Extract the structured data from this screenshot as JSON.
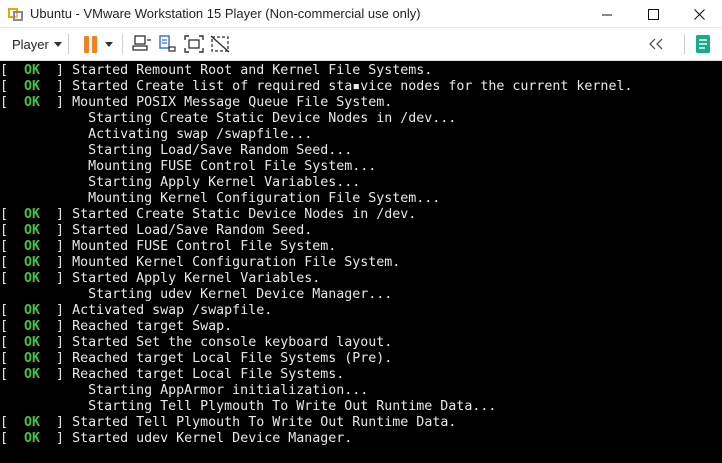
{
  "window": {
    "title": "Ubuntu - VMware Workstation 15 Player (Non-commercial use only)"
  },
  "toolbar": {
    "player_label": "Player",
    "icons": [
      "pause-icon",
      "dropdown-icon",
      "send-ctrl-alt-del-icon",
      "removable-devices-icon",
      "fit-guest-icon",
      "unity-icon",
      "back-icon",
      "library-notes-icon"
    ]
  },
  "colors": {
    "ok": "#3dc63d",
    "pause": "#f08020",
    "notes": "#1aaa8a",
    "console_text": "#e8e8e8"
  },
  "console": {
    "lines": [
      {
        "status": "OK",
        "text": "Started Remount Root and Kernel File Systems."
      },
      {
        "status": "OK",
        "text": "Started Create list of required sta▪vice nodes for the current kernel."
      },
      {
        "status": "OK",
        "text": "Mounted POSIX Message Queue File System."
      },
      {
        "status": "",
        "text": "Starting Create Static Device Nodes in /dev..."
      },
      {
        "status": "",
        "text": "Activating swap /swapfile..."
      },
      {
        "status": "",
        "text": "Starting Load/Save Random Seed..."
      },
      {
        "status": "",
        "text": "Mounting FUSE Control File System..."
      },
      {
        "status": "",
        "text": "Starting Apply Kernel Variables..."
      },
      {
        "status": "",
        "text": "Mounting Kernel Configuration File System..."
      },
      {
        "status": "OK",
        "text": "Started Create Static Device Nodes in /dev."
      },
      {
        "status": "OK",
        "text": "Started Load/Save Random Seed."
      },
      {
        "status": "OK",
        "text": "Mounted FUSE Control File System."
      },
      {
        "status": "OK",
        "text": "Mounted Kernel Configuration File System."
      },
      {
        "status": "OK",
        "text": "Started Apply Kernel Variables."
      },
      {
        "status": "",
        "text": "Starting udev Kernel Device Manager..."
      },
      {
        "status": "OK",
        "text": "Activated swap /swapfile."
      },
      {
        "status": "OK",
        "text": "Reached target Swap."
      },
      {
        "status": "OK",
        "text": "Started Set the console keyboard layout."
      },
      {
        "status": "OK",
        "text": "Reached target Local File Systems (Pre)."
      },
      {
        "status": "OK",
        "text": "Reached target Local File Systems."
      },
      {
        "status": "",
        "text": "Starting AppArmor initialization..."
      },
      {
        "status": "",
        "text": "Starting Tell Plymouth To Write Out Runtime Data..."
      },
      {
        "status": "OK",
        "text": "Started Tell Plymouth To Write Out Runtime Data."
      },
      {
        "status": "OK",
        "text": "Started udev Kernel Device Manager."
      }
    ]
  }
}
